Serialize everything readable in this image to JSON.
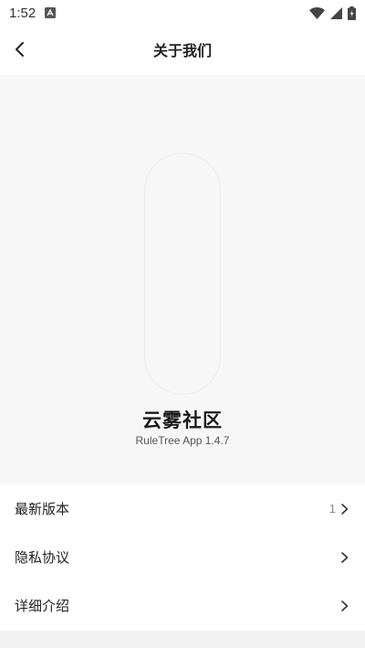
{
  "status_bar": {
    "time": "1:52",
    "notification_icon": "a-notification-icon",
    "wifi_icon": "wifi-icon",
    "signal_icon": "signal-icon",
    "battery_icon": "battery-icon"
  },
  "app_bar": {
    "title": "关于我们",
    "back_icon": "chevron-left-icon"
  },
  "hero": {
    "app_name": "云雾社区",
    "version": "RuleTree App 1.4.7"
  },
  "menu": {
    "items": [
      {
        "label": "最新版本",
        "value": "1"
      },
      {
        "label": "隐私协议",
        "value": ""
      },
      {
        "label": "详细介绍",
        "value": ""
      }
    ]
  },
  "colors": {
    "background": "#ffffff",
    "hero_background": "#f7f7f7",
    "text": "#222222",
    "muted": "#888888"
  }
}
